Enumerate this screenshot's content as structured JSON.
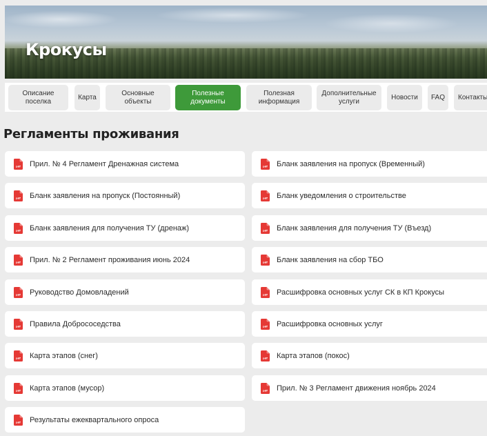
{
  "header": {
    "title": "Крокусы"
  },
  "nav": {
    "items": [
      {
        "label": "Описание\nпоселка",
        "active": false
      },
      {
        "label": "Карта",
        "active": false
      },
      {
        "label": "Основные\nобъекты",
        "active": false
      },
      {
        "label": "Полезные\nдокументы",
        "active": true
      },
      {
        "label": "Полезная\nинформация",
        "active": false
      },
      {
        "label": "Дополнительные\nуслуги",
        "active": false
      },
      {
        "label": "Новости",
        "active": false
      },
      {
        "label": "FAQ",
        "active": false
      },
      {
        "label": "Контакты",
        "active": false
      }
    ]
  },
  "section": {
    "title": "Регламенты проживания"
  },
  "documents": {
    "left": [
      {
        "label": "Прил. № 4 Регламент Дренажная система",
        "icon": "pdf-icon"
      },
      {
        "label": "Бланк заявления на пропуск (Постоянный)",
        "icon": "pdf-icon"
      },
      {
        "label": "Бланк заявления для получения ТУ (дренаж)",
        "icon": "pdf-icon"
      },
      {
        "label": "Прил. № 2 Регламент проживания июнь 2024",
        "icon": "pdf-icon"
      },
      {
        "label": "Руководство Домовладений",
        "icon": "pdf-icon"
      },
      {
        "label": "Правила Добрососедства",
        "icon": "pdf-icon"
      },
      {
        "label": "Карта этапов (снег)",
        "icon": "pdf-icon"
      },
      {
        "label": "Карта этапов (мусор)",
        "icon": "pdf-icon"
      },
      {
        "label": "Результаты ежеквартального опроса",
        "icon": "pdf-icon"
      }
    ],
    "right": [
      {
        "label": "Бланк заявления на пропуск (Временный)",
        "icon": "pdf-icon"
      },
      {
        "label": "Бланк уведомления о строительстве",
        "icon": "pdf-icon"
      },
      {
        "label": "Бланк заявления для получения ТУ (Въезд)",
        "icon": "pdf-icon"
      },
      {
        "label": "Бланк заявления на сбор ТБО",
        "icon": "pdf-icon"
      },
      {
        "label": "Расшифровка основных услуг СК в КП Крокусы",
        "icon": "pdf-icon"
      },
      {
        "label": "Расшифровка основных услуг",
        "icon": "pdf-icon"
      },
      {
        "label": "Карта этапов (покос)",
        "icon": "pdf-icon"
      },
      {
        "label": "Прил. № 3 Регламент движения ноябрь 2024",
        "icon": "pdf-icon"
      }
    ]
  },
  "colors": {
    "accent": "#3e9a3a",
    "pdf_red": "#e53935",
    "background": "#ececec"
  }
}
